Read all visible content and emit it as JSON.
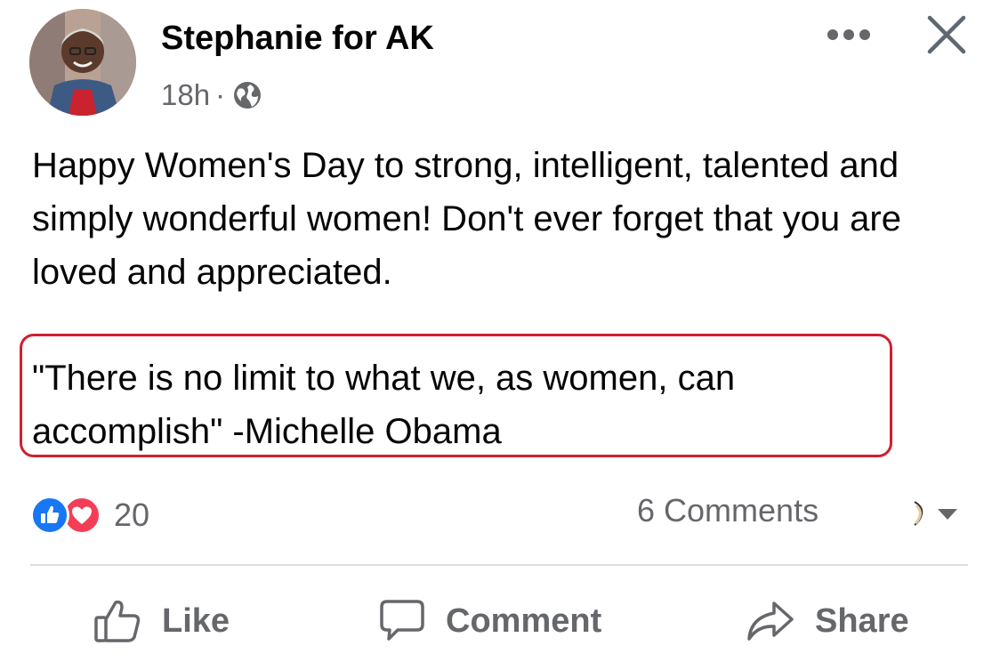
{
  "post": {
    "author": "Stephanie for AK",
    "time": "18h",
    "separator": "·",
    "audience_icon": "globe-icon",
    "body": "Happy Women's Day to strong, intelligent, talented and simply wonderful women! Don't ever forget that you are loved and appreciated.",
    "quote": "\"There is no limit to what we, as women, can accomplish\" -Michelle Obama",
    "highlight_color": "#d01f2e"
  },
  "header": {
    "more_icon": "more-horizontal-icon",
    "close_icon": "close-icon"
  },
  "stats": {
    "reaction_icons": [
      "like-reaction-icon",
      "love-reaction-icon"
    ],
    "reaction_count": "20",
    "comments": "6 Comments"
  },
  "actions": {
    "like": "Like",
    "comment": "Comment",
    "share": "Share"
  },
  "colors": {
    "text": "#050505",
    "secondary_text": "#65676b",
    "like_blue": "#1877f2",
    "love_red": "#f33e58",
    "divider": "#dadde1"
  }
}
